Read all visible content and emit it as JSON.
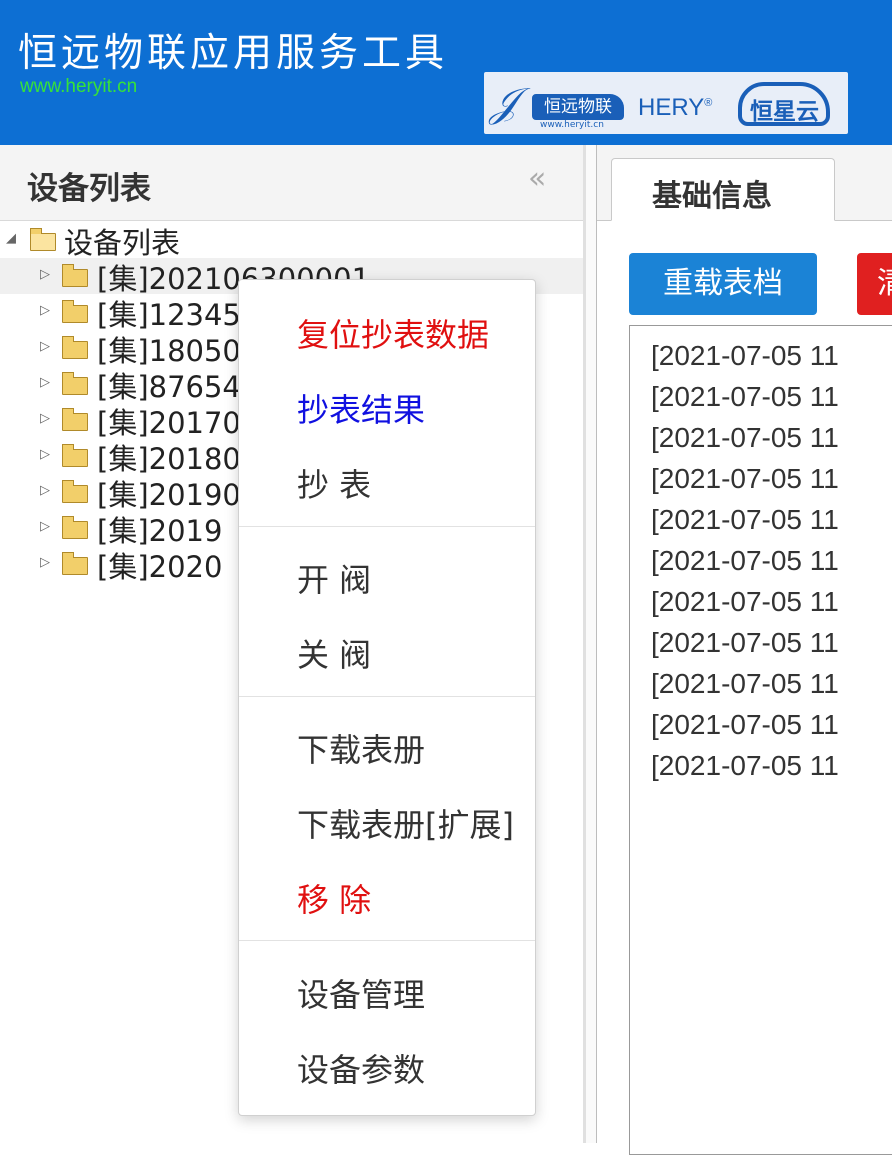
{
  "header": {
    "title": "恒远物联应用服务工具",
    "url": "www.heryit.cn",
    "logo": {
      "brand_cn": "恒远物联",
      "brand_url": "www.heryit.cn",
      "brand_en": "HERY",
      "cloud": "恒星云"
    }
  },
  "sidebar": {
    "title": "设备列表",
    "collapse_icon": "«",
    "root_label": "设备列表",
    "items": [
      {
        "label": "[集]202106300001"
      },
      {
        "label": "[集]12345"
      },
      {
        "label": "[集]18050"
      },
      {
        "label": "[集]87654"
      },
      {
        "label": "[集]20170"
      },
      {
        "label": "[集]20180"
      },
      {
        "label": "[集]20190"
      },
      {
        "label": "[集]2019"
      },
      {
        "label": "[集]2020"
      }
    ]
  },
  "main": {
    "tab_label": "基础信息",
    "reload_button": "重载表档",
    "red_button": "清",
    "log_lines": [
      "[2021-07-05 11",
      "[2021-07-05 11",
      "[2021-07-05 11",
      "[2021-07-05 11",
      "[2021-07-05 11",
      "[2021-07-05 11",
      "[2021-07-05 11",
      "[2021-07-05 11",
      "[2021-07-05 11",
      "[2021-07-05 11",
      "[2021-07-05 11"
    ]
  },
  "context_menu": {
    "items": [
      {
        "label": "复位抄表数据",
        "color": "#e01010"
      },
      {
        "label": "抄表结果",
        "color": "#1010e0"
      },
      {
        "label": "抄 表",
        "color": "#333333"
      },
      {
        "label": "开 阀",
        "color": "#333333"
      },
      {
        "label": "关 阀",
        "color": "#333333"
      },
      {
        "label": "下载表册",
        "color": "#333333"
      },
      {
        "label": "下载表册[扩展]",
        "color": "#333333"
      },
      {
        "label": "移 除",
        "color": "#e01010"
      },
      {
        "label": "设备管理",
        "color": "#333333"
      },
      {
        "label": "设备参数",
        "color": "#333333"
      }
    ]
  },
  "colors": {
    "header_bg": "#0d6fd3",
    "url_green": "#36e23a",
    "primary_button": "#1b83d6",
    "danger_button": "#e02020"
  }
}
